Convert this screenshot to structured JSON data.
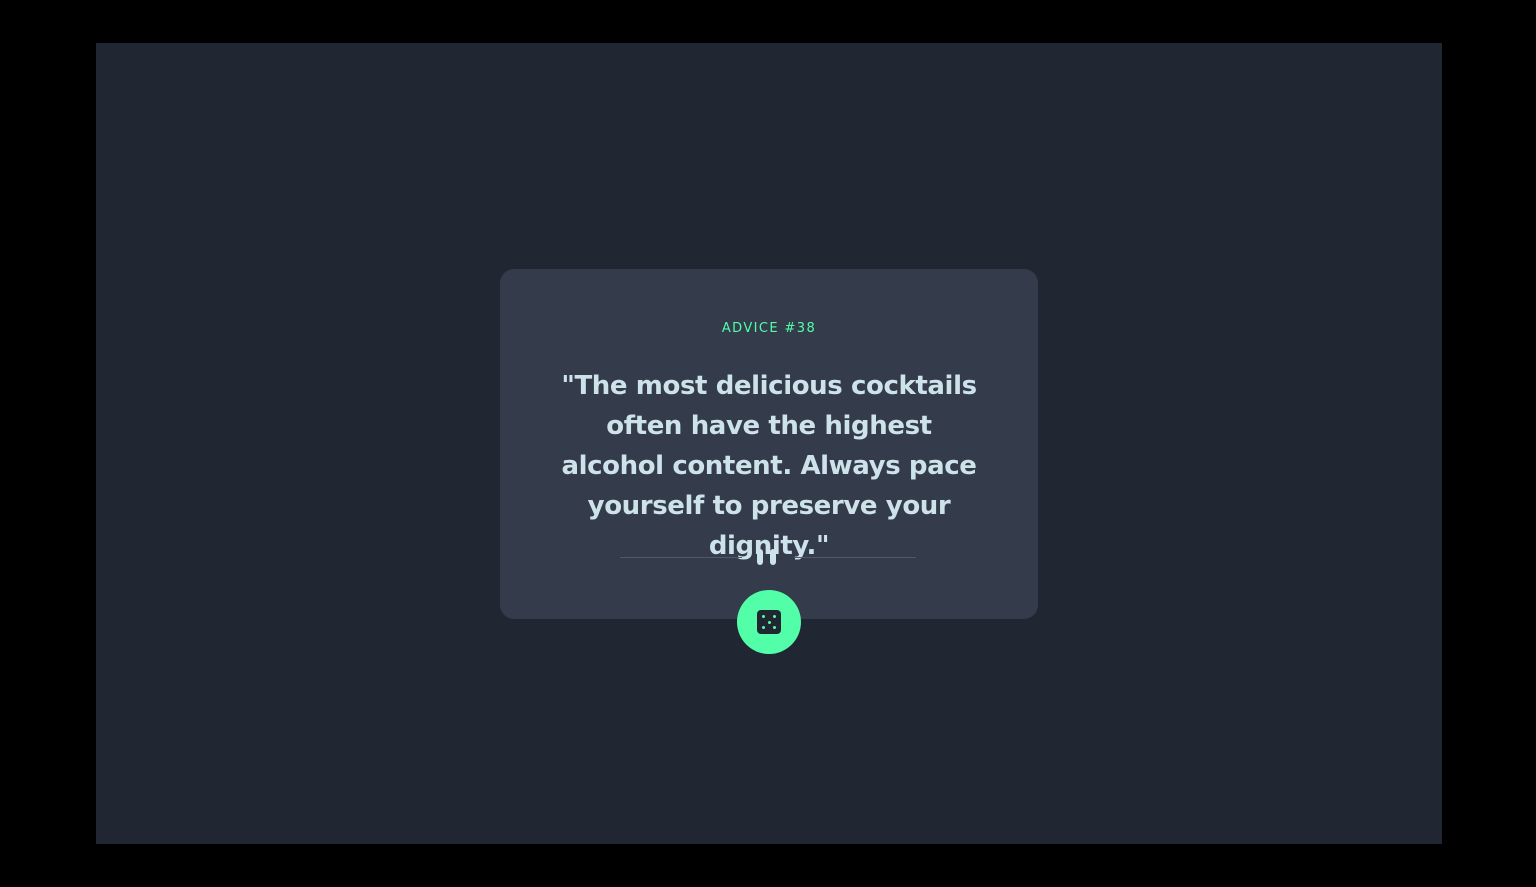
{
  "advice": {
    "label": "ADVICE #38",
    "quote": "\"The most delicious cocktails often have the highest alcohol content. Always pace yourself to preserve your dignity.\""
  },
  "divider": {
    "icon": "pause-icon"
  },
  "button": {
    "icon": "dice-icon"
  },
  "colors": {
    "background": "#202632",
    "card": "#343b4b",
    "accent": "#52ffa8",
    "text": "#cee3e9",
    "divider_line": "#4f5a6d"
  }
}
